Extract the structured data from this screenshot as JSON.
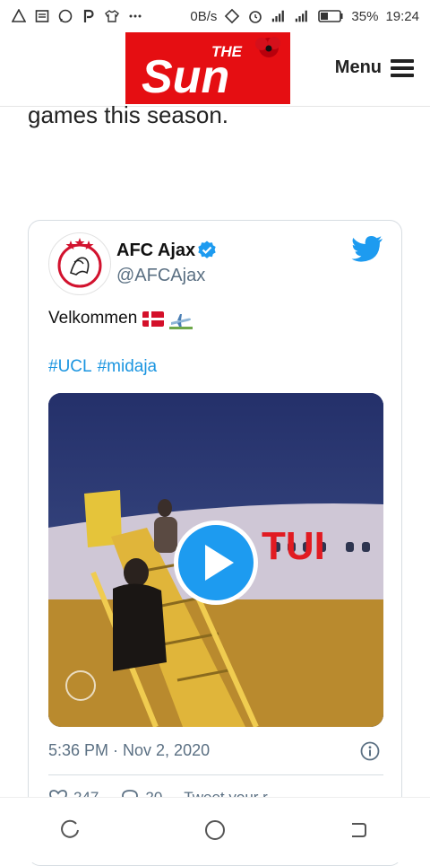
{
  "status_bar": {
    "speed": "0B/s",
    "battery": "35%",
    "time": "19:24",
    "icons_left": [
      "warning-icon",
      "news-icon",
      "whatsapp-icon",
      "paypal-icon",
      "shirt-icon",
      "more-icon"
    ],
    "icons_right": [
      "screen-rotate-icon",
      "alarm-icon",
      "signal-icon",
      "signal-icon",
      "battery-icon"
    ]
  },
  "header": {
    "logo_text": "THE Sun",
    "logo_small": "THE",
    "logo_big": "Sun",
    "menu_label": "Menu"
  },
  "article": {
    "fragment": "games this season."
  },
  "tweet": {
    "name": "AFC Ajax",
    "handle": "@AFCAjax",
    "text": "Velkommen",
    "hashtags": [
      "#UCL",
      "#midaja"
    ],
    "timestamp": "5:36 PM · Nov 2, 2020",
    "actions": {
      "likes": "247",
      "replies": "20",
      "share": "Tweet your r"
    }
  },
  "colors": {
    "brand_red": "#e50e12",
    "twitter_blue": "#1d9bf0",
    "hashtag_blue": "#1b95e0",
    "meta_gray": "#5b7083"
  }
}
